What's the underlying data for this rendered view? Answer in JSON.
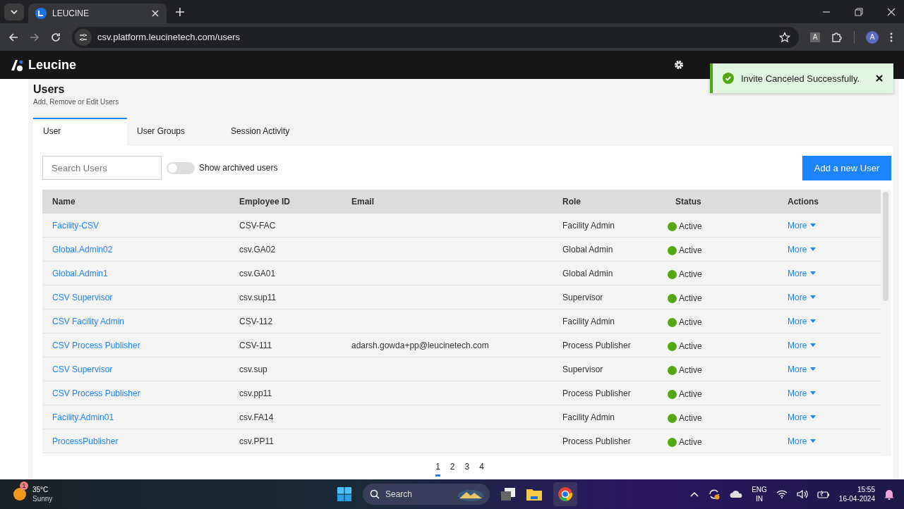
{
  "browser": {
    "tab_title": "LEUCINE",
    "url": "csv.platform.leucinetech.com/users",
    "profile_initial": "A",
    "translate_label": "A"
  },
  "app": {
    "brand": "Leucine"
  },
  "toast": {
    "message": "Invite Canceled Successfully.",
    "kind": "success"
  },
  "page": {
    "title": "Users",
    "subtitle": "Add, Remove or Edit Users"
  },
  "tabs": [
    {
      "label": "User",
      "selected": true
    },
    {
      "label": "User Groups",
      "selected": false
    },
    {
      "label": "Session Activity",
      "selected": false
    }
  ],
  "search": {
    "placeholder": "Search Users"
  },
  "archived_toggle": {
    "label": "Show archived users",
    "on": false
  },
  "add_button": "Add a new User",
  "table": {
    "columns": [
      "Name",
      "Employee ID",
      "Email",
      "Role",
      "Status",
      "Actions"
    ],
    "rows": [
      {
        "name": "Facility-CSV",
        "employee_id": "CSV-FAC",
        "email": "",
        "role": "Facility Admin",
        "status": "Active",
        "kind": "active",
        "action": "More"
      },
      {
        "name": "Global.Admin02",
        "employee_id": "csv.GA02",
        "email": "",
        "role": "Global Admin",
        "status": "Active",
        "kind": "active",
        "action": "More"
      },
      {
        "name": "Global.Admin1",
        "employee_id": "csv.GA01",
        "email": "",
        "role": "Global Admin",
        "status": "Active",
        "kind": "active",
        "action": "More"
      },
      {
        "name": "CSV Supervisor",
        "employee_id": "csv.sup11",
        "email": "",
        "role": "Supervisor",
        "status": "Active",
        "kind": "active",
        "action": "More"
      },
      {
        "name": "CSV Facility Admin",
        "employee_id": "CSV-112",
        "email": "",
        "role": "Facility Admin",
        "status": "Active",
        "kind": "active",
        "action": "More"
      },
      {
        "name": "CSV Process Publisher",
        "employee_id": "CSV-111",
        "email": "adarsh.gowda+pp@leucinetech.com",
        "role": "Process Publisher",
        "status": "Active",
        "kind": "active",
        "action": "More"
      },
      {
        "name": "CSV Supervisor",
        "employee_id": "csv.sup",
        "email": "",
        "role": "Supervisor",
        "status": "Active",
        "kind": "active",
        "action": "More"
      },
      {
        "name": "CSV Process Publisher",
        "employee_id": "csv.pp11",
        "email": "",
        "role": "Process Publisher",
        "status": "Active",
        "kind": "active",
        "action": "More"
      },
      {
        "name": "Facility.Admin01",
        "employee_id": "csv.FA14",
        "email": "",
        "role": "Facility Admin",
        "status": "Active",
        "kind": "active",
        "action": "More"
      },
      {
        "name": "ProcessPublisher",
        "employee_id": "csv.PP11",
        "email": "",
        "role": "Process Publisher",
        "status": "Active",
        "kind": "active",
        "action": "More"
      }
    ]
  },
  "pagination": [
    {
      "label": "1",
      "selected": true
    },
    {
      "label": "2",
      "selected": false
    },
    {
      "label": "3",
      "selected": false
    },
    {
      "label": "4",
      "selected": false
    }
  ],
  "taskbar": {
    "weather": {
      "temperature": "35°C",
      "condition": "Sunny",
      "badge": "1"
    },
    "search": "Search",
    "language": "ENG",
    "region": "IN",
    "time": "15:55",
    "date": "16-04-2024"
  }
}
